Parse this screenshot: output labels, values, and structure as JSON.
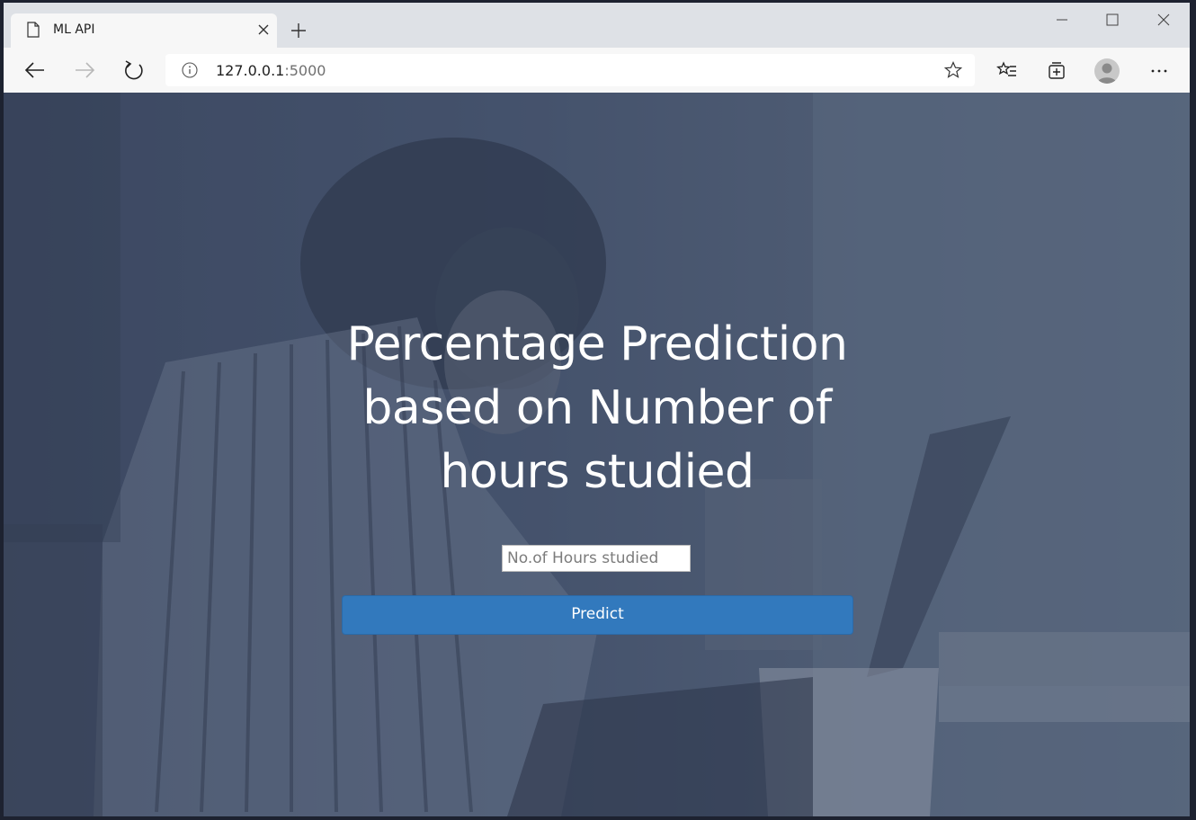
{
  "browser": {
    "tab": {
      "title": "ML API",
      "icon": "page-icon"
    },
    "address": {
      "host": "127.0.0.1",
      "port": ":5000"
    },
    "colors": {
      "tabstrip": "#dee1e6",
      "toolbar": "#f7f7f7"
    }
  },
  "page": {
    "heading": "Percentage Prediction based on Number of hours studied",
    "hours_input": {
      "placeholder": "No.of Hours studied",
      "value": ""
    },
    "predict_label": "Predict",
    "colors": {
      "button": "#3279bd",
      "text": "#ffffff"
    }
  }
}
